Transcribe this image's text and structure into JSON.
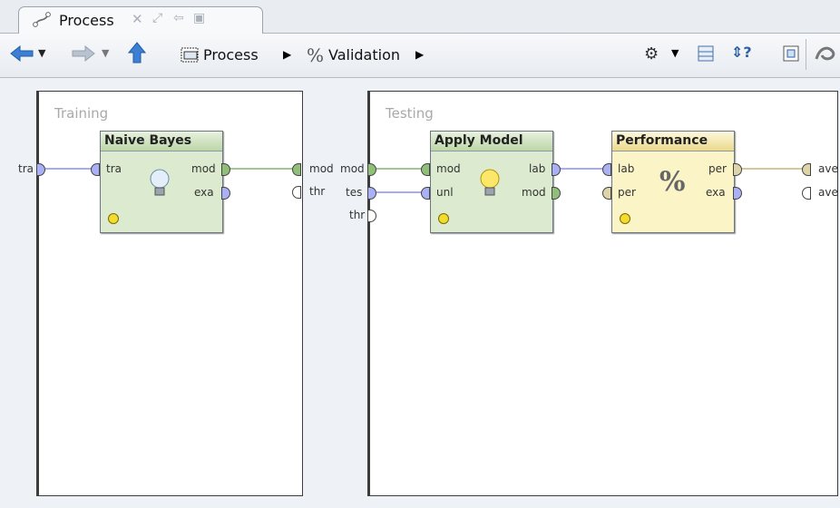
{
  "tab": {
    "label": "Process"
  },
  "toolbar": {
    "breadcrumb_process": "Process",
    "breadcrumb_validation": "Validation"
  },
  "training": {
    "title": "Training",
    "input_label": "tra",
    "output_labels": [
      "mod",
      "thr"
    ]
  },
  "testing": {
    "title": "Testing",
    "input_labels": [
      "mod",
      "tes",
      "thr"
    ],
    "output_labels": [
      "ave",
      "ave"
    ]
  },
  "operators": {
    "naive_bayes": {
      "title": "Naive Bayes",
      "in": [
        "tra"
      ],
      "out": [
        "mod",
        "exa"
      ]
    },
    "apply_model": {
      "title": "Apply Model",
      "in": [
        "mod",
        "unl"
      ],
      "out": [
        "lab",
        "mod"
      ]
    },
    "performance": {
      "title": "Performance",
      "in": [
        "lab",
        "per"
      ],
      "out": [
        "per",
        "exa"
      ],
      "icon_glyph": "%"
    }
  },
  "colors": {
    "connector_purple": "#8a8ff0",
    "connector_green": "#7fb56c",
    "connector_tan": "#c8b47a"
  }
}
